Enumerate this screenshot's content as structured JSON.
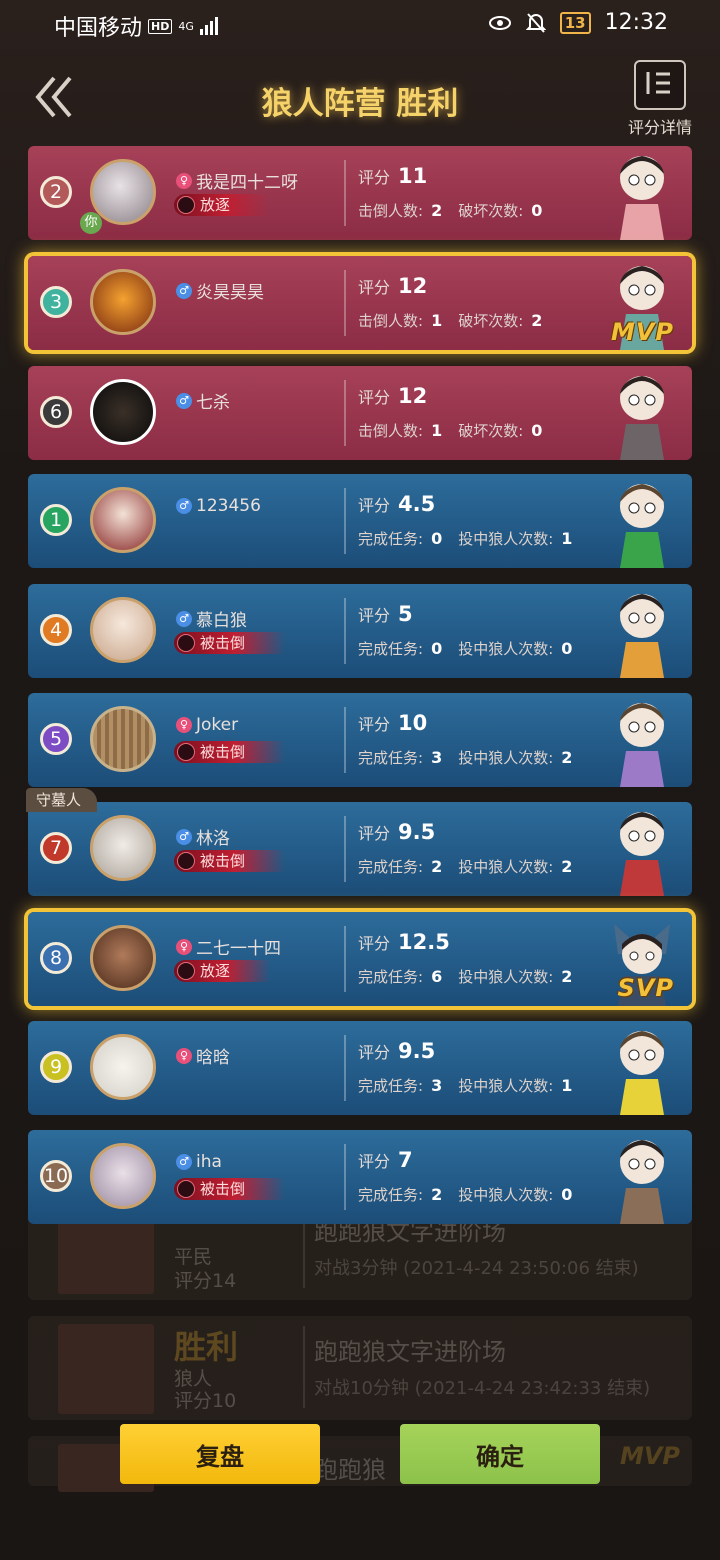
{
  "status_bar": {
    "carrier": "中国移动",
    "hd": "HD",
    "network": "4G",
    "battery": "13",
    "time": "12:32"
  },
  "header": {
    "title": "狼人阵营 胜利",
    "detail_label": "评分详情"
  },
  "players": [
    {
      "seat": "2",
      "name": "我是四十二呀",
      "gender": "♀",
      "tag": "放逐",
      "score_label": "评分",
      "score": "11",
      "stat1_label": "击倒人数:",
      "stat1": "2",
      "stat2_label": "破坏次数:",
      "stat2": "0",
      "you_label": "你"
    },
    {
      "seat": "3",
      "name": "炎昊昊昊",
      "gender": "♂",
      "score_label": "评分",
      "score": "12",
      "stat1_label": "击倒人数:",
      "stat1": "1",
      "stat2_label": "破坏次数:",
      "stat2": "2",
      "badge": "MVP"
    },
    {
      "seat": "6",
      "name": "七杀",
      "gender": "♂",
      "score_label": "评分",
      "score": "12",
      "stat1_label": "击倒人数:",
      "stat1": "1",
      "stat2_label": "破坏次数:",
      "stat2": "0"
    },
    {
      "seat": "1",
      "name": "123456",
      "gender": "♂",
      "score_label": "评分",
      "score": "4.5",
      "stat1_label": "完成任务:",
      "stat1": "0",
      "stat2_label": "投中狼人次数:",
      "stat2": "1"
    },
    {
      "seat": "4",
      "name": "慕白狼",
      "gender": "♂",
      "tag": "被击倒",
      "score_label": "评分",
      "score": "5",
      "stat1_label": "完成任务:",
      "stat1": "0",
      "stat2_label": "投中狼人次数:",
      "stat2": "0"
    },
    {
      "seat": "5",
      "name": "Joker",
      "gender": "♀",
      "tag": "被击倒",
      "score_label": "评分",
      "score": "10",
      "stat1_label": "完成任务:",
      "stat1": "3",
      "stat2_label": "投中狼人次数:",
      "stat2": "2"
    },
    {
      "seat": "7",
      "name": "林洛",
      "gender": "♂",
      "tag": "被击倒",
      "role": "守墓人",
      "score_label": "评分",
      "score": "9.5",
      "stat1_label": "完成任务:",
      "stat1": "2",
      "stat2_label": "投中狼人次数:",
      "stat2": "2"
    },
    {
      "seat": "8",
      "name": "二七一十四",
      "gender": "♀",
      "tag": "放逐",
      "score_label": "评分",
      "score": "12.5",
      "stat1_label": "完成任务:",
      "stat1": "6",
      "stat2_label": "投中狼人次数:",
      "stat2": "2",
      "badge": "SVP"
    },
    {
      "seat": "9",
      "name": "晗晗",
      "gender": "♀",
      "score_label": "评分",
      "score": "9.5",
      "stat1_label": "完成任务:",
      "stat1": "3",
      "stat2_label": "投中狼人次数:",
      "stat2": "1"
    },
    {
      "seat": "10",
      "name": "iha",
      "gender": "♂",
      "tag": "被击倒",
      "score_label": "评分",
      "score": "7",
      "stat1_label": "完成任务:",
      "stat1": "2",
      "stat2_label": "投中狼人次数:",
      "stat2": "0"
    }
  ],
  "background_list": [
    {
      "role": "平民",
      "score": "评分14",
      "title": "跑跑狼文字进阶场",
      "sub": "对战3分钟 (2021-4-24 23:50:06 结束)"
    },
    {
      "result": "胜利",
      "role": "狼人",
      "score": "评分10",
      "title": "跑跑狼文字进阶场",
      "sub": "对战10分钟 (2021-4-24 23:42:33 结束)"
    },
    {
      "title": "跑跑狼",
      "mvp": "MVP"
    }
  ],
  "buttons": {
    "replay": "复盘",
    "confirm": "确定"
  },
  "colors": {
    "wolf_card": "#a64158",
    "good_card": "#2d6c9b",
    "highlight": "#f3c437",
    "title": "#f6d36a",
    "replay_btn": "#ffd034",
    "confirm_btn": "#a6d35a"
  },
  "icons": {
    "back": "double-chevron-left-icon",
    "detail": "list-detail-icon",
    "female": "female-icon",
    "male": "male-icon"
  }
}
